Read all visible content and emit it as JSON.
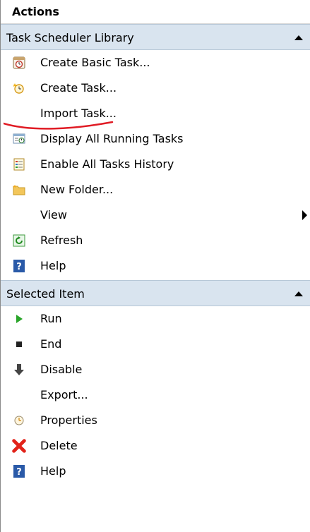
{
  "pane": {
    "title": "Actions",
    "sections": [
      {
        "header": "Task Scheduler Library",
        "items": [
          {
            "label": "Create Basic Task...",
            "icon": "calendar-clock-icon"
          },
          {
            "label": "Create Task...",
            "icon": "clock-star-icon"
          },
          {
            "label": "Import Task...",
            "icon": ""
          },
          {
            "label": "Display All Running Tasks",
            "icon": "running-tasks-icon"
          },
          {
            "label": "Enable All Tasks History",
            "icon": "history-list-icon"
          },
          {
            "label": "New Folder...",
            "icon": "folder-icon"
          },
          {
            "label": "View",
            "icon": "",
            "submenu": true
          },
          {
            "label": "Refresh",
            "icon": "refresh-icon"
          },
          {
            "label": "Help",
            "icon": "help-icon"
          }
        ]
      },
      {
        "header": "Selected Item",
        "items": [
          {
            "label": "Run",
            "icon": "run-icon"
          },
          {
            "label": "End",
            "icon": "stop-icon"
          },
          {
            "label": "Disable",
            "icon": "disable-arrow-icon"
          },
          {
            "label": "Export...",
            "icon": ""
          },
          {
            "label": "Properties",
            "icon": "properties-clock-icon"
          },
          {
            "label": "Delete",
            "icon": "delete-x-icon"
          },
          {
            "label": "Help",
            "icon": "help-icon"
          }
        ]
      }
    ]
  },
  "colors": {
    "header_bg": "#d9e4ef",
    "annotation": "#e01b24"
  }
}
